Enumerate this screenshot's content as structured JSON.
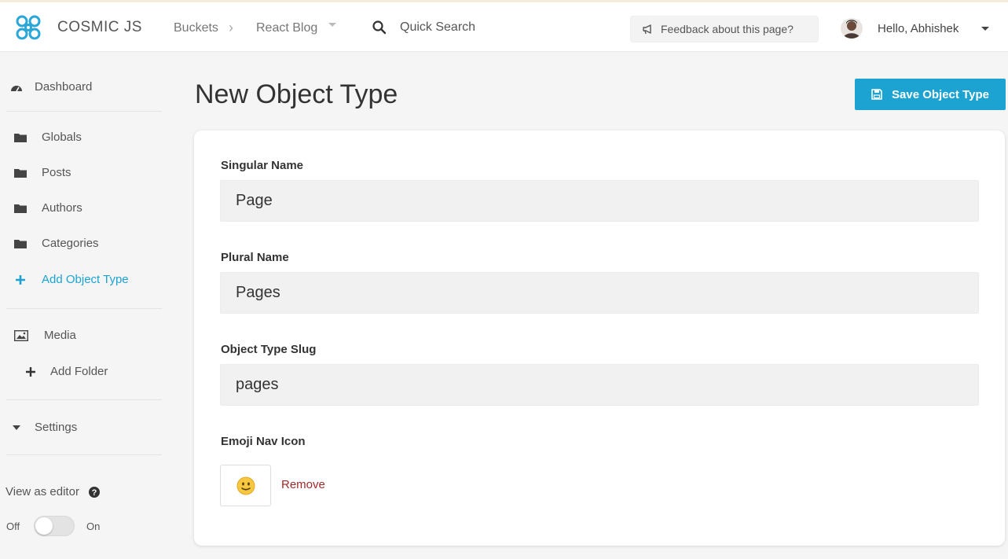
{
  "brand": {
    "name": "COSMIC JS",
    "accent": "#1ca3d2"
  },
  "header": {
    "breadcrumb": [
      "Buckets",
      "React Blog"
    ],
    "search_label": "Quick Search",
    "feedback_label": "Feedback about this page?",
    "user_greeting": "Hello, Abhishek"
  },
  "sidebar": {
    "dashboard": "Dashboard",
    "object_types": [
      "Globals",
      "Posts",
      "Authors",
      "Categories"
    ],
    "add_object_type": "Add Object Type",
    "media": "Media",
    "add_folder": "Add Folder",
    "settings": "Settings",
    "view_as_editor": "View as editor",
    "toggle_off": "Off",
    "toggle_on": "On",
    "toggle_state": "off"
  },
  "main": {
    "title": "New Object Type",
    "save_label": "Save Object Type",
    "fields": [
      {
        "label": "Singular Name",
        "value": "Page"
      },
      {
        "label": "Plural Name",
        "value": "Pages"
      },
      {
        "label": "Object Type Slug",
        "value": "pages"
      }
    ],
    "emoji_label": "Emoji Nav Icon",
    "emoji_icon": "slightly-smiling-face-icon",
    "remove_label": "Remove"
  }
}
